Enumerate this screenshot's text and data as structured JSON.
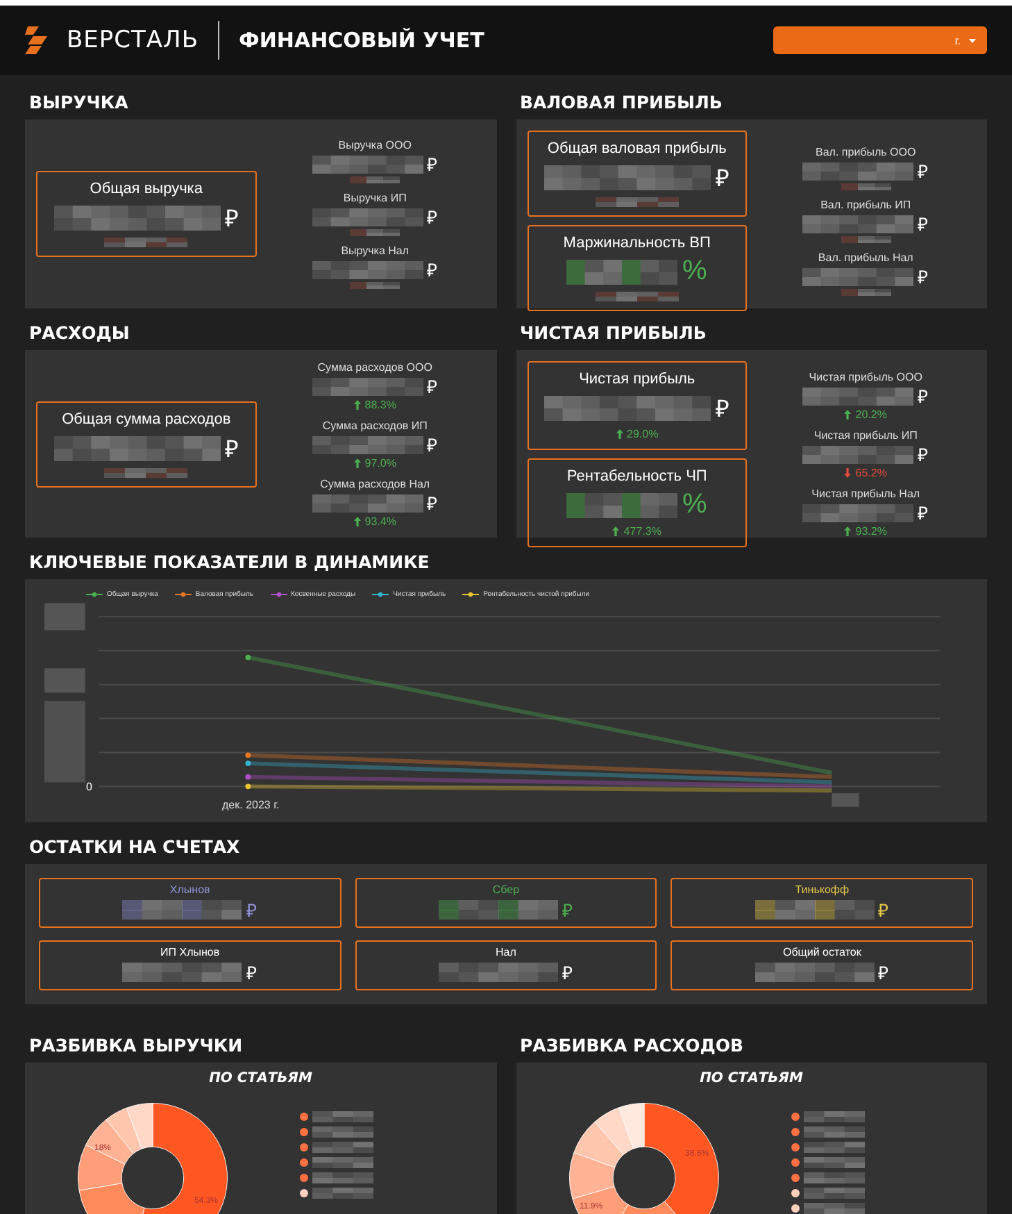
{
  "header": {
    "logo": "ВЕРСТАЛЬ",
    "title": "ФИНАНСОВЫЙ УЧЕТ",
    "period": {
      "label": "г."
    }
  },
  "kpi_sections": [
    {
      "title": "ВЫРУЧКА",
      "main": [
        {
          "label": "Общая выручка",
          "unit": "₽"
        }
      ],
      "side": [
        {
          "label": "Выручка ООО",
          "unit": "₽"
        },
        {
          "label": "Выручка ИП",
          "unit": "₽"
        },
        {
          "label": "Выручка Нал",
          "unit": "₽"
        }
      ]
    },
    {
      "title": "ВАЛОВАЯ ПРИБЫЛЬ",
      "main": [
        {
          "label": "Общая валовая прибыль",
          "unit": "₽"
        },
        {
          "label": "Маржинальность ВП",
          "unit": "%"
        }
      ],
      "side": [
        {
          "label": "Вал. прибыль ООО",
          "unit": "₽"
        },
        {
          "label": "Вал. прибыль ИП",
          "unit": "₽"
        },
        {
          "label": "Вал. прибыль Нал",
          "unit": "₽"
        }
      ]
    },
    {
      "title": "РАСХОДЫ",
      "main": [
        {
          "label": "Общая сумма расходов",
          "unit": "₽"
        }
      ],
      "side": [
        {
          "label": "Сумма расходов ООО",
          "unit": "₽",
          "delta": {
            "text": "88.3%",
            "rising": true
          }
        },
        {
          "label": "Сумма расходов ИП",
          "unit": "₽",
          "delta": {
            "text": "97.0%",
            "rising": true
          }
        },
        {
          "label": "Сумма расходов Нал",
          "unit": "₽",
          "delta": {
            "text": "93.4%",
            "rising": true
          }
        }
      ]
    },
    {
      "title": "ЧИСТАЯ ПРИБЫЛЬ",
      "main": [
        {
          "label": "Чистая прибыль",
          "unit": "₽",
          "delta": {
            "text": "29.0%",
            "rising": true
          }
        },
        {
          "label": "Рентабельность ЧП",
          "unit": "%",
          "delta": {
            "text": "477.3%",
            "rising": true
          }
        }
      ],
      "side": [
        {
          "label": "Чистая прибыль ООО",
          "unit": "₽",
          "delta": {
            "text": "20.2%",
            "rising": true
          }
        },
        {
          "label": "Чистая прибыль ИП",
          "unit": "₽",
          "delta": {
            "text": "65.2%",
            "rising": false
          }
        },
        {
          "label": "Чистая прибыль Нал",
          "unit": "₽",
          "delta": {
            "text": "93.2%",
            "rising": true
          }
        }
      ]
    }
  ],
  "dynamics": {
    "title": "КЛЮЧЕВЫЕ ПОКАЗАТЕЛИ В ДИНАМИКЕ",
    "legend": [
      {
        "label": "Общая выручка",
        "color": "#4caf50"
      },
      {
        "label": "Валовая прибыль",
        "color": "#e87722"
      },
      {
        "label": "Косвенные расходы",
        "color": "#b04fc8"
      },
      {
        "label": "Чистая прибыль",
        "color": "#33b5d0"
      },
      {
        "label": "Рентабельность чистой прибыли",
        "color": "#e8c530"
      }
    ],
    "y_label": "0",
    "x_label": "дек. 2023 г."
  },
  "accounts": {
    "title": "ОСТАТКИ НА СЧЕТАХ",
    "items": [
      {
        "label": "Хлынов",
        "unit": "₽",
        "color": "#8f93d6"
      },
      {
        "label": "Сбер",
        "unit": "₽",
        "color": "#4caf50"
      },
      {
        "label": "Тинькофф",
        "unit": "₽",
        "color": "#e6c84a"
      },
      {
        "label": "ИП Хлынов",
        "unit": "₽",
        "color": "#ffffff"
      },
      {
        "label": "Нал",
        "unit": "₽",
        "color": "#ffffff"
      },
      {
        "label": "Общий остаток",
        "unit": "₽",
        "color": "#ffffff"
      }
    ]
  },
  "breakdowns": [
    {
      "title": "РАЗБИВКА ВЫРУЧКИ",
      "subtitle": "ПО СТАТЬЯМ",
      "slice_labels": [
        "54.3%",
        "18%"
      ],
      "legend": [
        {
          "color": "#ff7043"
        },
        {
          "color": "#ff7043"
        },
        {
          "color": "#ff7043"
        },
        {
          "color": "#ff7043"
        },
        {
          "color": "#ff7043"
        },
        {
          "color": "#ffd0bd"
        }
      ]
    },
    {
      "title": "РАЗБИВКА РАСХОДОВ",
      "subtitle": "ПО СТАТЬЯМ",
      "slice_labels": [
        "38.6%",
        "11.9%"
      ],
      "legend": [
        {
          "color": "#ff7043"
        },
        {
          "color": "#ff7043"
        },
        {
          "color": "#ff7043"
        },
        {
          "color": "#ff7043"
        },
        {
          "color": "#ff7043"
        },
        {
          "color": "#ffd0bd"
        },
        {
          "color": "#ffd0bd"
        }
      ]
    }
  ]
}
